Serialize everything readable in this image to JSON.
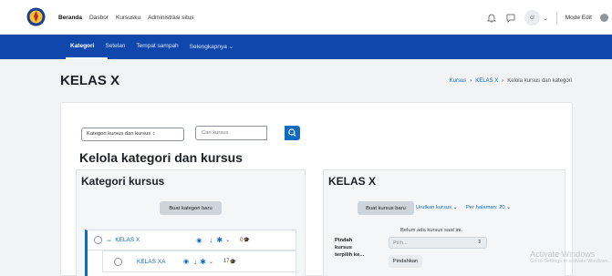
{
  "topbar": {
    "nav": [
      "Beranda",
      "Dasbor",
      "Kursusku",
      "Administrasi situs"
    ],
    "avatar_initials": "cr",
    "mode_edit": "Mode Edit"
  },
  "secondary_nav": {
    "tabs": [
      "Kategori",
      "Setelan",
      "Tempat sampah",
      "Selengkapnya ⌄"
    ]
  },
  "page": {
    "title": "KELAS X",
    "breadcrumb": [
      "Kursus",
      "KELAS X",
      "Kelola kursus dan kategori"
    ]
  },
  "controls": {
    "view_select": "Kategori kursus dan kursus ↕",
    "search_placeholder": "Cari kursus"
  },
  "manage": {
    "heading": "Kelola kategori dan kursus",
    "categories": {
      "heading": "Kategori kursus",
      "new_button": "Buat kategori baru",
      "rows": [
        {
          "name": "KELAS X",
          "count": "0",
          "expand": "−"
        },
        {
          "name": "KELAS XA",
          "count": "17"
        }
      ]
    },
    "courses": {
      "heading": "KELAS X",
      "new_button": "Buat kursus baru",
      "sort": "Urutkan kursus ⌄",
      "per_page": "Per halaman: 20 ⌄",
      "empty": "Belum ada kursus saat ini.",
      "move_label": "Pindah kursus terpilih ke...",
      "move_select": "Pilih...",
      "move_button": "Pindahkan"
    }
  },
  "watermark": {
    "title": "Activate Windows",
    "subtitle": "Go to Settings to activate Windows."
  }
}
